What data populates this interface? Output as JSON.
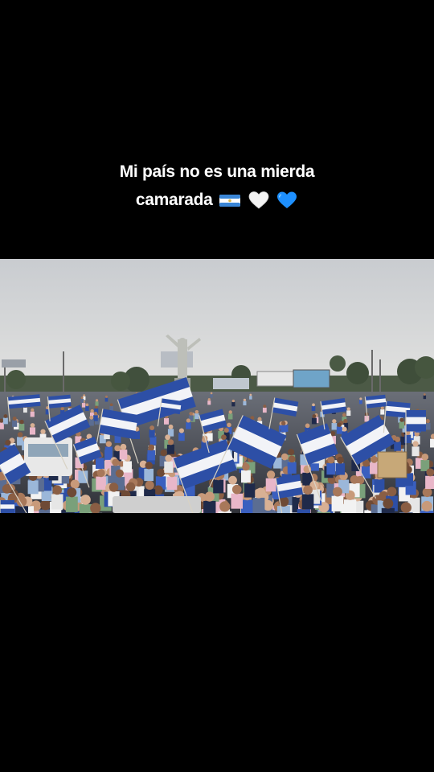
{
  "caption": {
    "line1": "Mi país no es una mierda",
    "line2": "camarada"
  },
  "emojis": [
    "nicaragua-flag-icon",
    "white-heart-icon",
    "blue-heart-icon"
  ],
  "photo": {
    "subject": "",
    "colors": {
      "flag_blue": "#2d4fa6",
      "flag_white": "#f2f3f7",
      "sky": "#d4d6d9"
    }
  }
}
